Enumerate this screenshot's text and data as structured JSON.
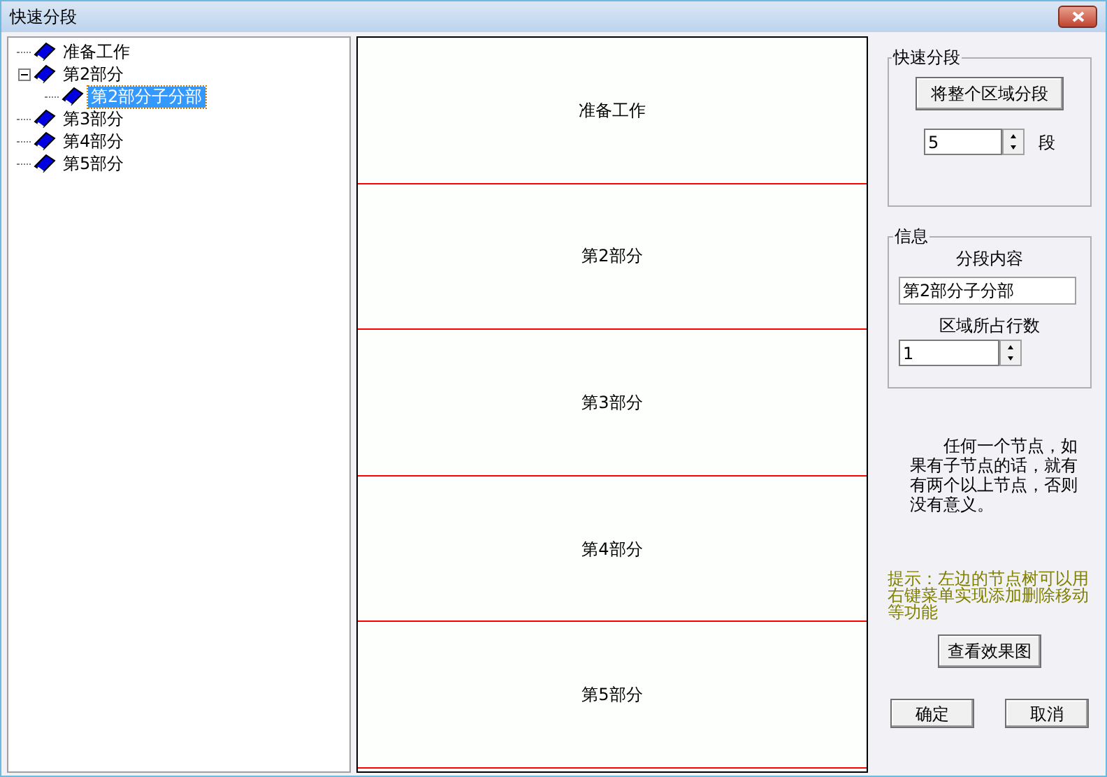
{
  "window": {
    "title": "快速分段"
  },
  "tree": [
    {
      "label": "准备工作",
      "selected": false
    },
    {
      "label": "第2部分",
      "selected": false,
      "expanded": true,
      "children": [
        {
          "label": "第2部分子分部",
          "selected": true
        }
      ]
    },
    {
      "label": "第3部分",
      "selected": false
    },
    {
      "label": "第4部分",
      "selected": false
    },
    {
      "label": "第5部分",
      "selected": false
    }
  ],
  "segments": [
    "准备工作",
    "第2部分",
    "第3部分",
    "第4部分",
    "第5部分"
  ],
  "quick_group": {
    "title": "快速分段",
    "button": "将整个区域分段",
    "count": "5",
    "unit": "段"
  },
  "info_group": {
    "title": "信息",
    "content_label": "分段内容",
    "content": "第2部分子分部",
    "rows_label": "区域所占行数",
    "rows": "1"
  },
  "note": "任何一个节点，如果有子节点的话，就有有两个以上节点，否则没有意义。",
  "hint": "提示：左边的节点树可以用右键菜单实现添加删除移动等功能",
  "preview_button": "查看效果图",
  "ok_button": "确定",
  "cancel_button": "取消"
}
